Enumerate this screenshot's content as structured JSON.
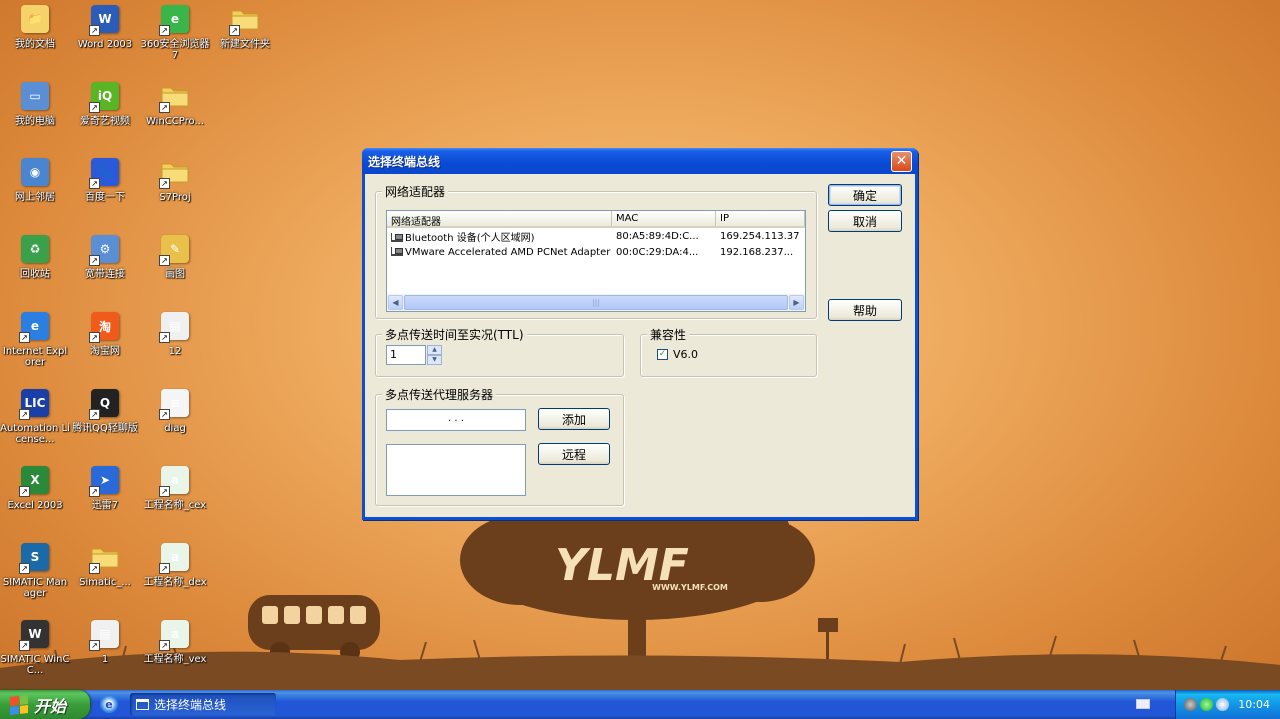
{
  "desktop": {
    "icons": [
      {
        "label": "我的文档",
        "icon": "my-documents-icon"
      },
      {
        "label": "Word 2003",
        "icon": "word-icon"
      },
      {
        "label": "360安全浏览器7",
        "icon": "browser-360-icon"
      },
      {
        "label": "新建文件夹",
        "icon": "folder-icon"
      },
      {
        "label": "我的电脑",
        "icon": "my-computer-icon"
      },
      {
        "label": "爱奇艺视频",
        "icon": "iqiyi-icon"
      },
      {
        "label": "WinCCPro...",
        "icon": "folder-icon"
      },
      {
        "label": "网上邻居",
        "icon": "network-places-icon"
      },
      {
        "label": "百度一下",
        "icon": "baidu-icon"
      },
      {
        "label": "S7Proj",
        "icon": "folder-icon"
      },
      {
        "label": "回收站",
        "icon": "recycle-bin-icon"
      },
      {
        "label": "宽带连接",
        "icon": "broadband-icon"
      },
      {
        "label": "画图",
        "icon": "paint-icon"
      },
      {
        "label": "Internet Explorer",
        "icon": "ie-icon"
      },
      {
        "label": "淘宝网",
        "icon": "taobao-icon"
      },
      {
        "label": "12",
        "icon": "document-icon"
      },
      {
        "label": "Automation License...",
        "icon": "license-icon"
      },
      {
        "label": "腾讯QQ轻聊版",
        "icon": "qq-icon"
      },
      {
        "label": "diag",
        "icon": "text-file-icon"
      },
      {
        "label": "Excel 2003",
        "icon": "excel-icon"
      },
      {
        "label": "迅雷7",
        "icon": "thunder-icon"
      },
      {
        "label": "工程名称_cex",
        "icon": "excel-file-icon"
      },
      {
        "label": "SIMATIC Manager",
        "icon": "simatic-icon"
      },
      {
        "label": "Simatic_...",
        "icon": "folder-icon"
      },
      {
        "label": "工程名称_dex",
        "icon": "excel-file-icon"
      },
      {
        "label": "SIMATIC WinCC...",
        "icon": "simatic-wincc-icon"
      },
      {
        "label": "1",
        "icon": "document-icon"
      },
      {
        "label": "工程名称_vex",
        "icon": "excel-file-icon"
      }
    ]
  },
  "wallpaper": {
    "brand": "YLMF",
    "url": "WWW.YLMF.COM"
  },
  "dialog": {
    "title": "选择终端总线",
    "close": "✕",
    "adapters": {
      "title": "网络适配器",
      "columns": [
        "网络适配器",
        "MAC",
        "IP"
      ],
      "rows": [
        {
          "name": "Bluetooth 设备(个人区域网)",
          "mac": "80:A5:89:4D:C...",
          "ip": "169.254.113.37"
        },
        {
          "name": "VMware Accelerated AMD PCNet Adapter",
          "mac": "00:0C:29:DA:4...",
          "ip": "192.168.237..."
        }
      ]
    },
    "ttl": {
      "title": "多点传送时间至实况(TTL)",
      "value": "1"
    },
    "compat": {
      "title": "兼容性",
      "checkbox_label": "V6.0",
      "checked": true
    },
    "proxy": {
      "title": "多点传送代理服务器",
      "ip_placeholder": ".      .      .",
      "add": "添加",
      "remote": "远程"
    },
    "buttons": {
      "ok": "确定",
      "cancel": "取消",
      "help": "帮助"
    }
  },
  "taskbar": {
    "start": "开始",
    "task": "选择终端总线",
    "clock": "10:04"
  },
  "colors": {
    "accent": "#0a4fd6",
    "dialog_bg": "#ece9d8",
    "taskbar": "#2157d7"
  }
}
